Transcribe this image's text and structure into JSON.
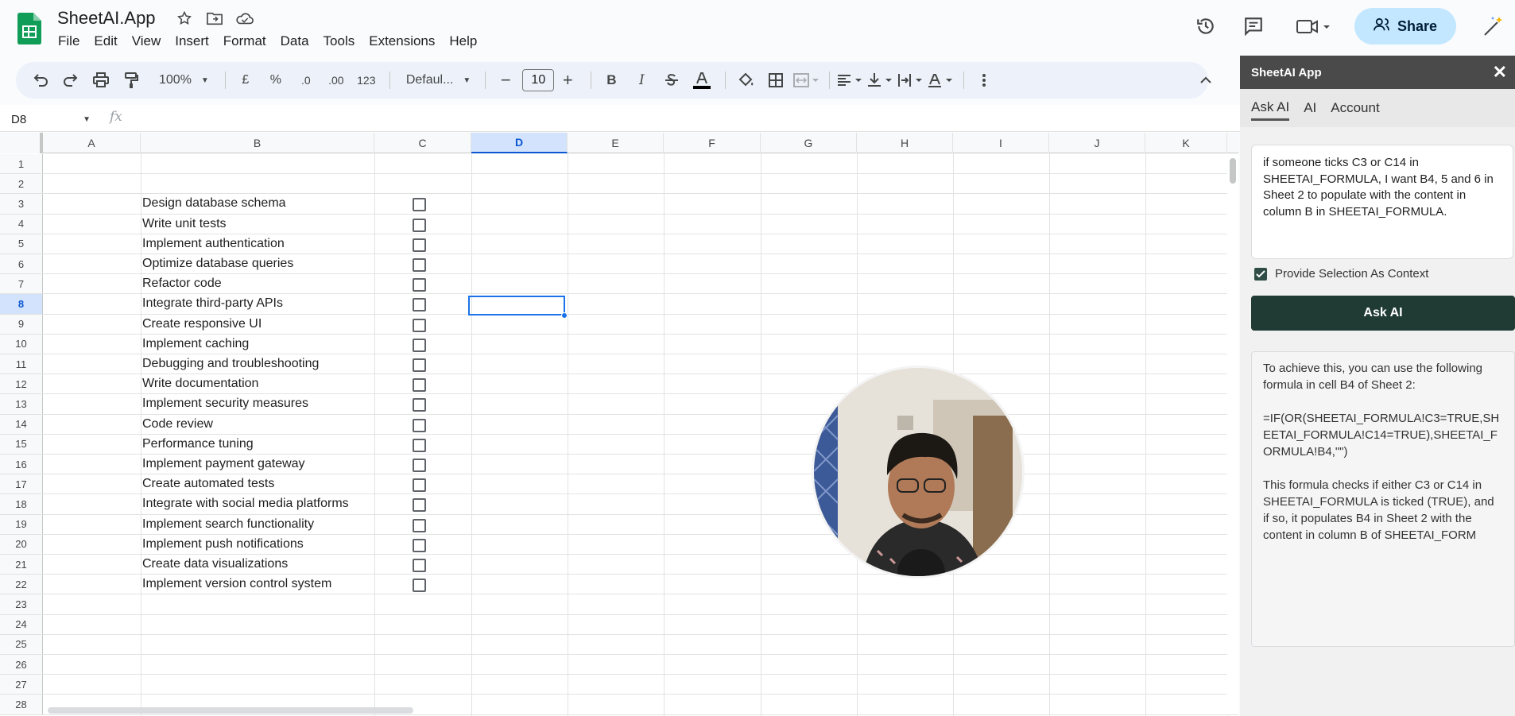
{
  "app": {
    "title": "SheetAI.App",
    "menu": [
      "File",
      "Edit",
      "View",
      "Insert",
      "Format",
      "Data",
      "Tools",
      "Extensions",
      "Help"
    ],
    "share_label": "Share",
    "icons": [
      "star-icon",
      "move-folder-icon",
      "cloud-icon",
      "history-icon",
      "comments-icon",
      "meet-icon",
      "share-person-icon",
      "gemini-icon"
    ]
  },
  "toolbar": {
    "zoom": "100%",
    "currency": "£",
    "percent": "%",
    "decrease_decimal": ".0",
    "increase_decimal": ".00",
    "number_format": "123",
    "font": "Defaul...",
    "font_size": "10",
    "bold": "B",
    "italic": "I"
  },
  "formula_bar": {
    "name_box": "D8",
    "fx": "fx",
    "formula": ""
  },
  "grid": {
    "columns": [
      "A",
      "B",
      "C",
      "D",
      "E",
      "F",
      "G",
      "H",
      "I",
      "J",
      "K"
    ],
    "active_column": "D",
    "active_row": 8,
    "rows": [
      1,
      2,
      3,
      4,
      5,
      6,
      7,
      8,
      9,
      10,
      11,
      12,
      13,
      14,
      15,
      16,
      17,
      18,
      19,
      20,
      21,
      22,
      23,
      24,
      25,
      26,
      27,
      28
    ],
    "tasks": [
      {
        "row": 3,
        "text": "Design database schema",
        "checked": false
      },
      {
        "row": 4,
        "text": "Write unit tests",
        "checked": false
      },
      {
        "row": 5,
        "text": "Implement authentication",
        "checked": false
      },
      {
        "row": 6,
        "text": "Optimize database queries",
        "checked": false
      },
      {
        "row": 7,
        "text": "Refactor code",
        "checked": false
      },
      {
        "row": 8,
        "text": "Integrate third-party APIs",
        "checked": false
      },
      {
        "row": 9,
        "text": "Create responsive UI",
        "checked": false
      },
      {
        "row": 10,
        "text": "Implement caching",
        "checked": false
      },
      {
        "row": 11,
        "text": "Debugging and troubleshooting",
        "checked": false
      },
      {
        "row": 12,
        "text": "Write documentation",
        "checked": false
      },
      {
        "row": 13,
        "text": "Implement security measures",
        "checked": false
      },
      {
        "row": 14,
        "text": "Code review",
        "checked": false
      },
      {
        "row": 15,
        "text": "Performance tuning",
        "checked": false
      },
      {
        "row": 16,
        "text": "Implement payment gateway",
        "checked": false
      },
      {
        "row": 17,
        "text": "Create automated tests",
        "checked": false
      },
      {
        "row": 18,
        "text": "Integrate with social media platforms",
        "checked": false
      },
      {
        "row": 19,
        "text": "Implement search functionality",
        "checked": false
      },
      {
        "row": 20,
        "text": "Implement push notifications",
        "checked": false
      },
      {
        "row": 21,
        "text": "Create data visualizations",
        "checked": false
      },
      {
        "row": 22,
        "text": "Implement version control system",
        "checked": false
      }
    ]
  },
  "side_panel": {
    "title": "SheetAI App",
    "close": "✕",
    "tabs": [
      "Ask AI",
      "AI",
      "Account"
    ],
    "active_tab": "Ask AI",
    "query": "if someone ticks C3 or C14  in SHEETAI_FORMULA, I want B4, 5 and 6 in Sheet 2 to populate with the content in column B in SHEETAI_FORMULA.",
    "context_label": "Provide Selection As Context",
    "context_checked": true,
    "ask_button": "Ask AI",
    "response": {
      "intro": "To achieve this, you can use the following formula in cell B4 of Sheet 2:",
      "formula": "=IF(OR(SHEETAI_FORMULA!C3=TRUE,SHEETAI_FORMULA!C14=TRUE),SHEETAI_FORMULA!B4,\"\")",
      "explanation": "This formula checks if either C3 or C14 in SHEETAI_FORMULA is ticked (TRUE), and if so, it populates B4 in Sheet 2 with the content in column B of SHEETAI_FORM"
    }
  },
  "colors": {
    "accent": "#0b57d0",
    "share_bg": "#c2e7ff",
    "panel_button": "#1f3b34",
    "sheets_green": "#0f9d58"
  }
}
